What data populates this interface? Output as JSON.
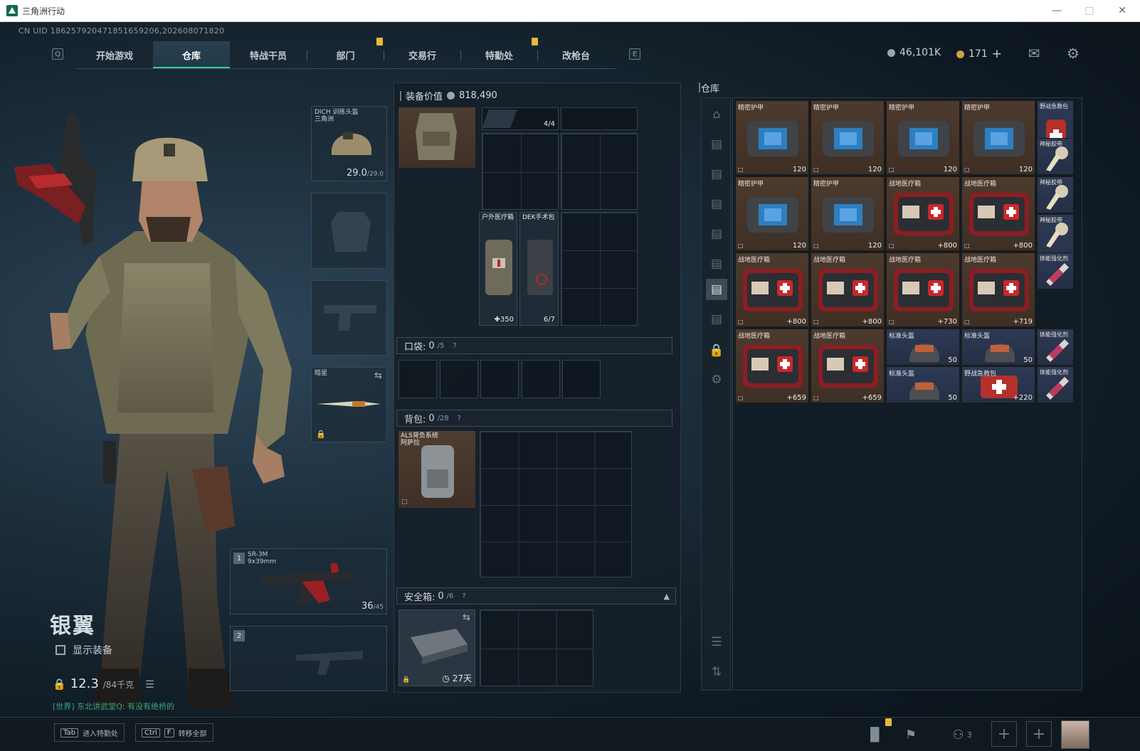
{
  "window": {
    "title": "三角洲行动"
  },
  "uid": "CN UID 186257920471851659206,202608071820",
  "nav": {
    "key_left": "Q",
    "key_right": "E",
    "tabs": [
      "开始游戏",
      "仓库",
      "特战干员",
      "部门",
      "交易行",
      "特勤处",
      "改枪台"
    ]
  },
  "currency": {
    "hafcoin": "46,101K",
    "coupon": "171"
  },
  "colors": {
    "accent": "#2ad29a",
    "marker": "#e8b83a"
  },
  "character": {
    "name": "银翼",
    "show_equipment": "显示装备",
    "weight": "12.3",
    "weight_max": "/84千克",
    "chat": "[世界] 东北讲武堂Q: 有没有绝桥的",
    "helmet": {
      "label": "DICH 训练头盔",
      "sub": "三角洲",
      "value": "29.0",
      "max": "/29.0"
    },
    "knife": {
      "label": "暗星"
    },
    "weapon1": {
      "num": "1",
      "label": "SR-3M",
      "sub": "9x39mm",
      "ammo": "36",
      "ammo_max": "/45"
    },
    "weapon2": {
      "num": "2"
    }
  },
  "equipment": {
    "title": "装备价值",
    "value": "818,490",
    "rig_count": "4/4",
    "medkit": {
      "label": "户外医疗箱",
      "value": "350"
    },
    "surgery": {
      "label": "DEK手术包",
      "value": "6/7"
    },
    "pocket": {
      "label": "口袋:",
      "count": "0",
      "max": "/5"
    },
    "backpack": {
      "label": "背包:",
      "count": "0",
      "max": "/28",
      "item_label": "ALS背负系统",
      "item_sub": "阿萨拉"
    },
    "safebox": {
      "label": "安全箱:",
      "count": "0",
      "max": "/6",
      "days": "27天"
    }
  },
  "warehouse": {
    "title": "仓库",
    "items": [
      {
        "label": "精密护甲",
        "value": "120",
        "color": "brown",
        "kind": "armor"
      },
      {
        "label": "精密护甲",
        "value": "120",
        "color": "brown",
        "kind": "armor"
      },
      {
        "label": "精密护甲",
        "value": "120",
        "color": "brown",
        "kind": "armor"
      },
      {
        "label": "精密护甲",
        "value": "120",
        "color": "brown",
        "kind": "armor"
      },
      {
        "label": "精密护甲",
        "value": "120",
        "color": "brown",
        "kind": "armor"
      },
      {
        "label": "精密护甲",
        "value": "120",
        "color": "brown",
        "kind": "armor"
      },
      {
        "label": "战地医疗箱",
        "value": "+800",
        "color": "brown",
        "kind": "med"
      },
      {
        "label": "战地医疗箱",
        "value": "+800",
        "color": "brown",
        "kind": "med"
      },
      {
        "label": "战地医疗箱",
        "value": "+800",
        "color": "brown",
        "kind": "med"
      },
      {
        "label": "战地医疗箱",
        "value": "+800",
        "color": "brown",
        "kind": "med"
      },
      {
        "label": "战地医疗箱",
        "value": "+730",
        "color": "brown",
        "kind": "med"
      },
      {
        "label": "战地医疗箱",
        "value": "+719",
        "color": "brown",
        "kind": "med"
      },
      {
        "label": "战地医疗箱",
        "value": "+659",
        "color": "brown",
        "kind": "med"
      },
      {
        "label": "战地医疗箱",
        "value": "+659",
        "color": "brown",
        "kind": "med"
      }
    ],
    "small": [
      {
        "label": "野战急救包",
        "value": "+220",
        "color": "blue"
      },
      {
        "label": "神秘胶带",
        "value": "",
        "color": "blue"
      },
      {
        "label": "神秘胶带",
        "value": "",
        "color": "blue"
      },
      {
        "label": "神秘胶带",
        "value": "",
        "color": "blue"
      },
      {
        "label": "体能强化剂",
        "value": "",
        "color": "blue"
      },
      {
        "label": "体能强化剂",
        "value": "",
        "color": "blue"
      },
      {
        "label": "体能强化剂",
        "value": "",
        "color": "blue"
      }
    ],
    "helmets": [
      {
        "label": "标准头盔",
        "value": "50"
      },
      {
        "label": "标准头盔",
        "value": "50"
      },
      {
        "label": "标准头盔",
        "value": "50"
      }
    ],
    "first_aid": {
      "label": "野战急救包",
      "value": "+220"
    }
  },
  "bottom": {
    "tab_key": "Tab",
    "tab_label": "进入特勤处",
    "ctrl_key": "Ctrl",
    "f_key": "F",
    "ctrl_label": "转移全部",
    "friends": "3"
  }
}
